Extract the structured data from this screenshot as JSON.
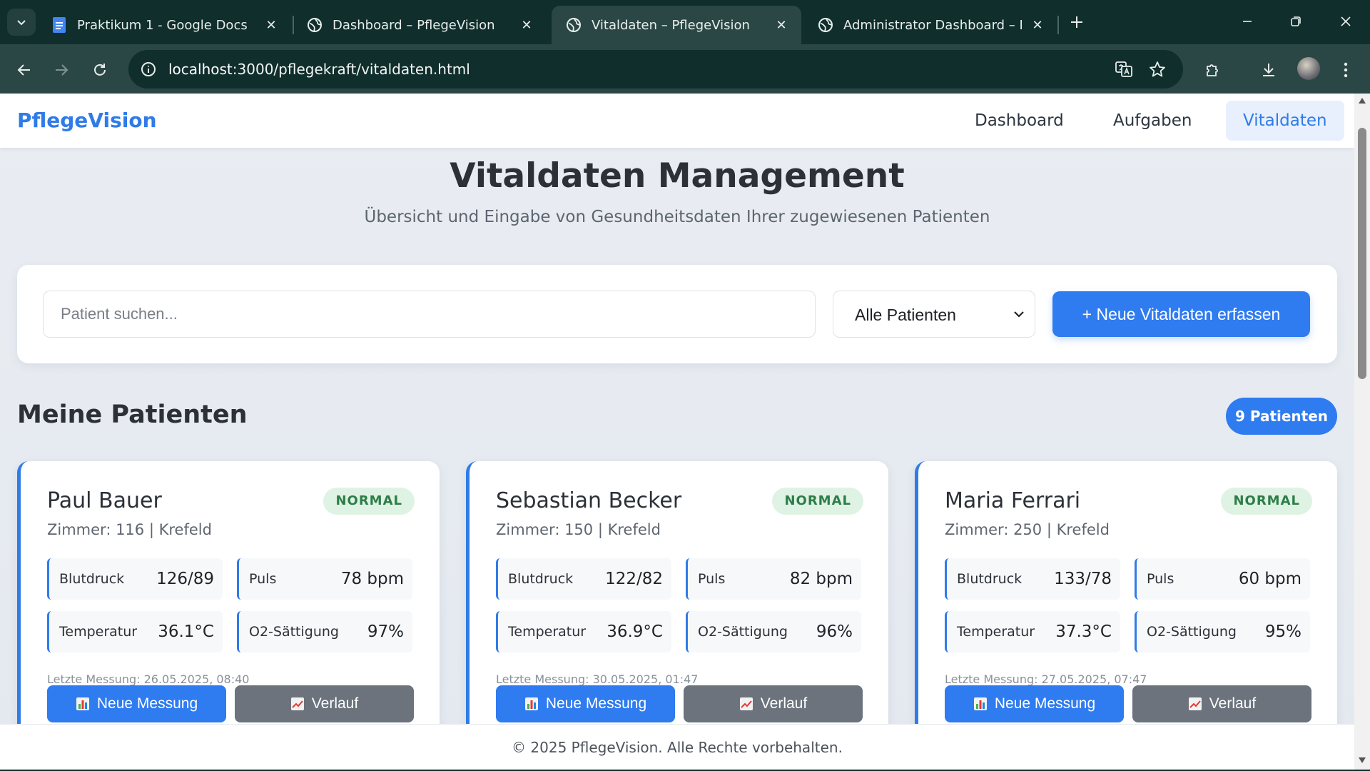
{
  "browser": {
    "tabs": [
      {
        "title": "Praktikum 1 - Google Docs",
        "favicon": "google-docs-icon",
        "active": false
      },
      {
        "title": "Dashboard – PflegeVision",
        "favicon": "globe-icon",
        "active": false
      },
      {
        "title": "Vitaldaten – PflegeVision",
        "favicon": "globe-icon",
        "active": true
      },
      {
        "title": "Administrator Dashboard – Pfle",
        "favicon": "globe-icon",
        "active": false
      }
    ],
    "url": {
      "host": "localhost",
      "rest": ":3000/pflegekraft/vitaldaten.html"
    }
  },
  "nav": {
    "brand": "PflegeVision",
    "links": [
      "Dashboard",
      "Aufgaben",
      "Vitaldaten"
    ],
    "active_link": "Vitaldaten"
  },
  "hero": {
    "title": "Vitaldaten Management",
    "subtitle": "Übersicht und Eingabe von Gesundheitsdaten Ihrer zugewiesenen Patienten"
  },
  "filters": {
    "search_placeholder": "Patient suchen...",
    "select_value": "Alle Patienten",
    "new_button": "+ Neue Vitaldaten erfassen"
  },
  "patients_section": {
    "title": "Meine Patienten",
    "count": "9 Patienten"
  },
  "patients": [
    {
      "name": "Paul Bauer",
      "status": "NORMAL",
      "room": "Zimmer: 116 | Krefeld",
      "vitals": [
        {
          "label": "Blutdruck",
          "value": "126/89"
        },
        {
          "label": "Puls",
          "value": "78 bpm"
        },
        {
          "label": "Temperatur",
          "value": "36.1°C"
        },
        {
          "label": "O2-Sättigung",
          "value": "97%"
        }
      ],
      "last": "Letzte Messung: 26.05.2025, 08:40",
      "btn_new": "Neue Messung",
      "btn_history": "Verlauf"
    },
    {
      "name": "Sebastian Becker",
      "status": "NORMAL",
      "room": "Zimmer: 150 | Krefeld",
      "vitals": [
        {
          "label": "Blutdruck",
          "value": "122/82"
        },
        {
          "label": "Puls",
          "value": "82 bpm"
        },
        {
          "label": "Temperatur",
          "value": "36.9°C"
        },
        {
          "label": "O2-Sättigung",
          "value": "96%"
        }
      ],
      "last": "Letzte Messung: 30.05.2025, 01:47",
      "btn_new": "Neue Messung",
      "btn_history": "Verlauf"
    },
    {
      "name": "Maria Ferrari",
      "status": "NORMAL",
      "room": "Zimmer: 250 | Krefeld",
      "vitals": [
        {
          "label": "Blutdruck",
          "value": "133/78"
        },
        {
          "label": "Puls",
          "value": "60 bpm"
        },
        {
          "label": "Temperatur",
          "value": "37.3°C"
        },
        {
          "label": "O2-Sättigung",
          "value": "95%"
        }
      ],
      "last": "Letzte Messung: 27.05.2025, 07:47",
      "btn_new": "Neue Messung",
      "btn_history": "Verlauf"
    }
  ],
  "footer": "© 2025 PflegeVision. Alle Rechte vorbehalten.",
  "colors": {
    "accent": "#2f7be8",
    "status_normal_bg": "#dff3e4",
    "status_normal_text": "#2e7d49",
    "secondary_button": "#6c737c"
  }
}
